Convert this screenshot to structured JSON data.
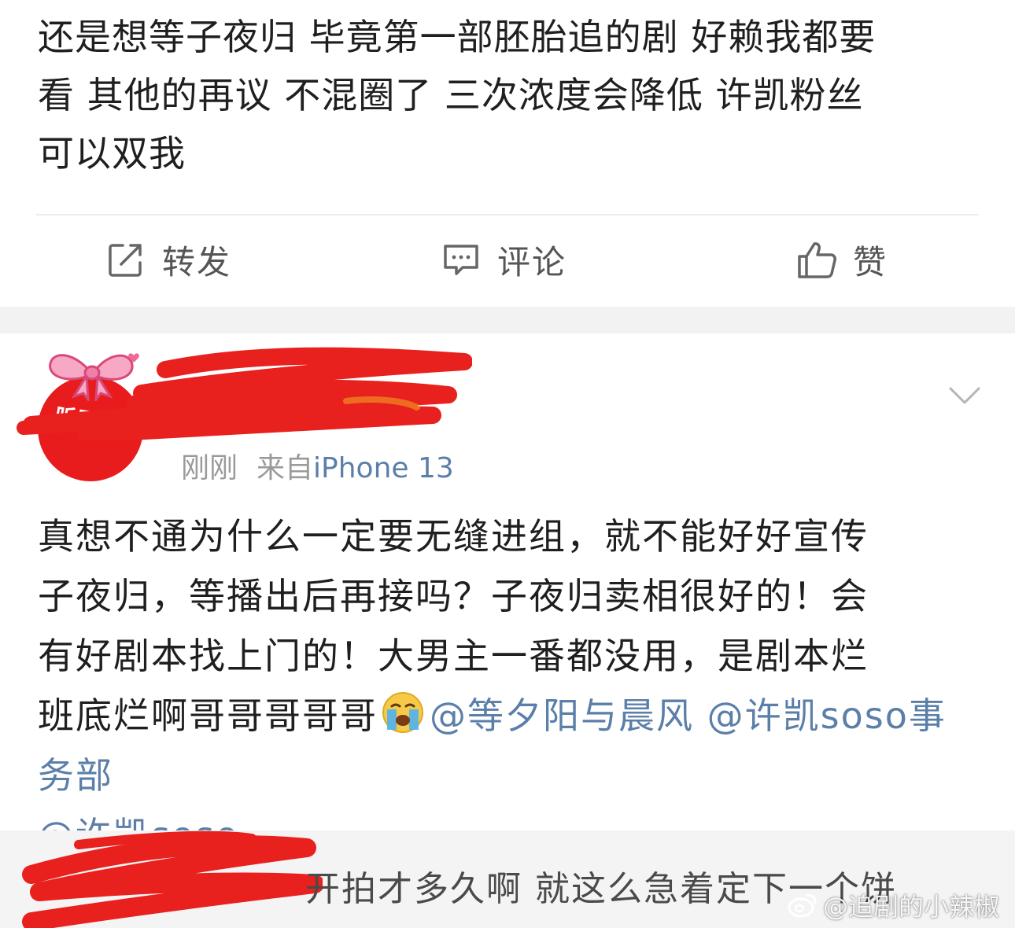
{
  "post1": {
    "text_lines": [
      "还是想等子夜归 毕竟第一部胚胎追的剧 好赖我都要",
      "看 其他的再议 不混圈了 三次浓度会降低 许凯粉丝",
      "可以双我"
    ],
    "actions": {
      "repost_label": "转发",
      "comment_label": "评论",
      "like_label": "赞"
    }
  },
  "post2": {
    "avatar_text": "听风令",
    "time": "刚刚",
    "source_prefix": "来自",
    "device": "iPhone 13",
    "text_lines": [
      "真想不通为什么一定要无缝进组，就不能好好宣传",
      "子夜归，等播出后再接吗？子夜归卖相很好的！会",
      "有好剧本找上门的！大男主一番都没用，是剧本烂"
    ],
    "line4_text": "班底烂啊哥哥哥哥哥",
    "mentions": [
      "@等夕阳与晨风",
      "@许凯soso事务部",
      "@许凯soso"
    ],
    "emoji": "loudly-crying-face"
  },
  "comment": {
    "text": "开拍才多久啊 就这么急着定下一个饼"
  },
  "watermark": {
    "text": "@追剧的小辣椒"
  },
  "colors": {
    "link": "#5b7fa8",
    "avatar": "#e81c1c",
    "redaction": "#e8201e",
    "band": "#f2f2f2"
  }
}
